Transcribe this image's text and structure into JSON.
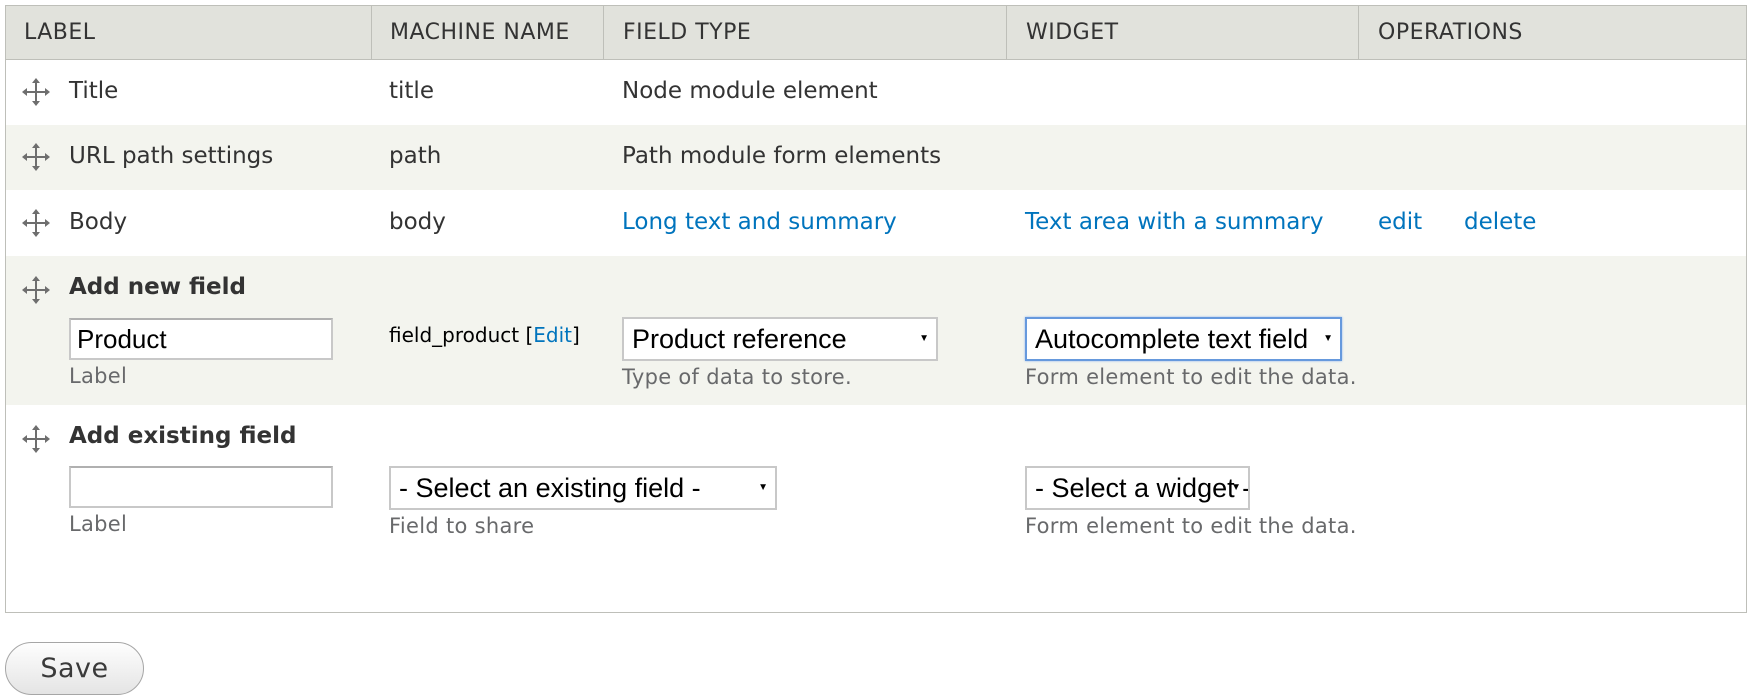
{
  "table": {
    "headers": [
      "LABEL",
      "MACHINE NAME",
      "FIELD TYPE",
      "WIDGET",
      "OPERATIONS"
    ],
    "rows": [
      {
        "label": "Title",
        "machine_name": "title",
        "field_type": "Node module element"
      },
      {
        "label": "URL path settings",
        "machine_name": "path",
        "field_type": "Path module form elements"
      },
      {
        "label": "Body",
        "machine_name": "body",
        "field_type": "Long text and summary",
        "widget": "Text area with a summary",
        "edit": "edit",
        "delete": "delete"
      }
    ]
  },
  "add_new_field": {
    "title": "Add new field",
    "label_value": "Product",
    "label_description": "Label",
    "machine_name": "field_product",
    "machine_edit_open": "[",
    "machine_edit_link": "Edit",
    "machine_edit_close": "]",
    "field_type_selected": "Product reference",
    "field_type_description": "Type of data to store.",
    "widget_selected": "Autocomplete text field",
    "widget_description": "Form element to edit the data."
  },
  "add_existing_field": {
    "title": "Add existing field",
    "label_value": "",
    "label_description": "Label",
    "field_selected": "- Select an existing field -",
    "field_description": "Field to share",
    "widget_selected": "- Select a widget -",
    "widget_description": "Form element to edit the data."
  },
  "save_label": "Save",
  "icons": {
    "drag": "move-cross-icon",
    "select_arrow": "triangle-down-icon"
  },
  "colors": {
    "link": "#0074bd",
    "header_bg": "#e1e2dc",
    "even_row_bg": "#f3f4ee",
    "focus_border": "#6699dd"
  }
}
